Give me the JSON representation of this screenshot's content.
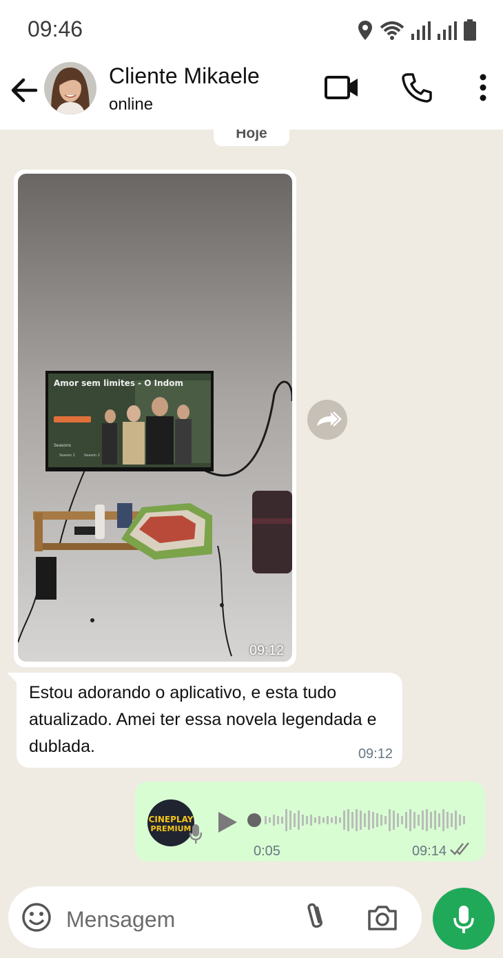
{
  "status_bar": {
    "time": "09:46"
  },
  "header": {
    "contact_name": "Cliente Mikaele",
    "status": "online"
  },
  "chat": {
    "date_chip": "Hoje",
    "image_message": {
      "time": "09:12",
      "tv_title": "Amor sem limites - O Indom",
      "tv_seasons_label": "Seasons",
      "tv_season_1": "Season 1",
      "tv_season_2": "Season 2"
    },
    "text_message": {
      "text": "Estou adorando o aplicativo, e esta tudo atualizado. Amei ter essa novela legendada e dublada.",
      "time": "09:12"
    },
    "voice_message": {
      "duration": "0:05",
      "time": "09:14",
      "avatar_line1": "CINEPLAY",
      "avatar_line2": "PREMIUM"
    }
  },
  "input_bar": {
    "placeholder": "Mensagem"
  },
  "colors": {
    "accent": "#21a95a",
    "outgoing_bubble": "#d9fdd3",
    "chat_bg": "#efeae2"
  }
}
